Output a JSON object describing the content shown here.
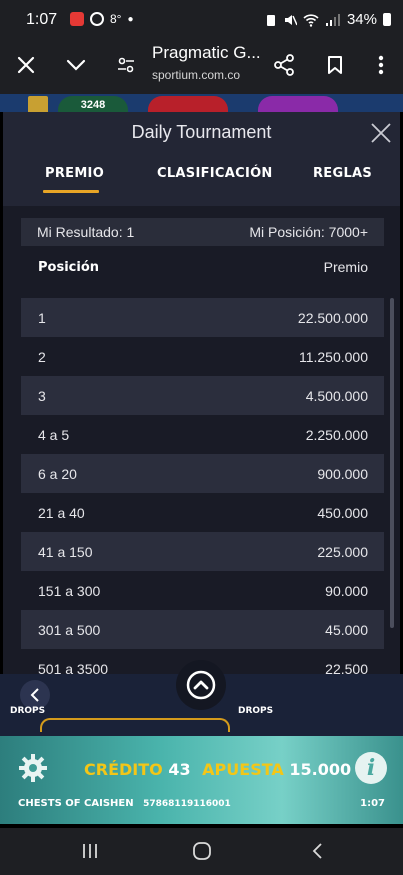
{
  "status_bar": {
    "time": "1:07",
    "temperature": "8°",
    "battery": "34%"
  },
  "browser": {
    "page_title": "Pragmatic G...",
    "url": "sportium.com.co"
  },
  "game_top": {
    "counter": "3248"
  },
  "modal": {
    "title": "Daily Tournament",
    "tabs": [
      {
        "label": "PREMIO",
        "active": true
      },
      {
        "label": "CLASIFICACIÓN",
        "active": false
      },
      {
        "label": "REGLAS",
        "active": false
      }
    ],
    "my_result_label": "Mi Resultado: 1",
    "my_position_label": "Mi Posición: 7000+",
    "header_position": "Posición",
    "header_prize": "Premio",
    "rows": [
      {
        "position": "1",
        "prize": "22.500.000"
      },
      {
        "position": "2",
        "prize": "11.250.000"
      },
      {
        "position": "3",
        "prize": "4.500.000"
      },
      {
        "position": "4 a 5",
        "prize": "2.250.000"
      },
      {
        "position": "6 a 20",
        "prize": "900.000"
      },
      {
        "position": "21 a 40",
        "prize": "450.000"
      },
      {
        "position": "41 a 150",
        "prize": "225.000"
      },
      {
        "position": "151 a 300",
        "prize": "90.000"
      },
      {
        "position": "301 a 500",
        "prize": "45.000"
      },
      {
        "position": "501 a 3500",
        "prize": "22.500"
      }
    ]
  },
  "game_bar": {
    "credit_label": "CRÉDITO",
    "credit_value": "43",
    "bet_label": "APUESTA",
    "bet_value": "15.000",
    "game_name": "CHESTS OF CAISHEN",
    "round_id": "57868119116001",
    "clock": "1:07",
    "drops_label": "DROPS"
  },
  "colors": {
    "accent": "#e8a526",
    "modal_bg": "#232635",
    "row_alt": "#2b2e3d",
    "credit_yellow": "#f3c617"
  }
}
